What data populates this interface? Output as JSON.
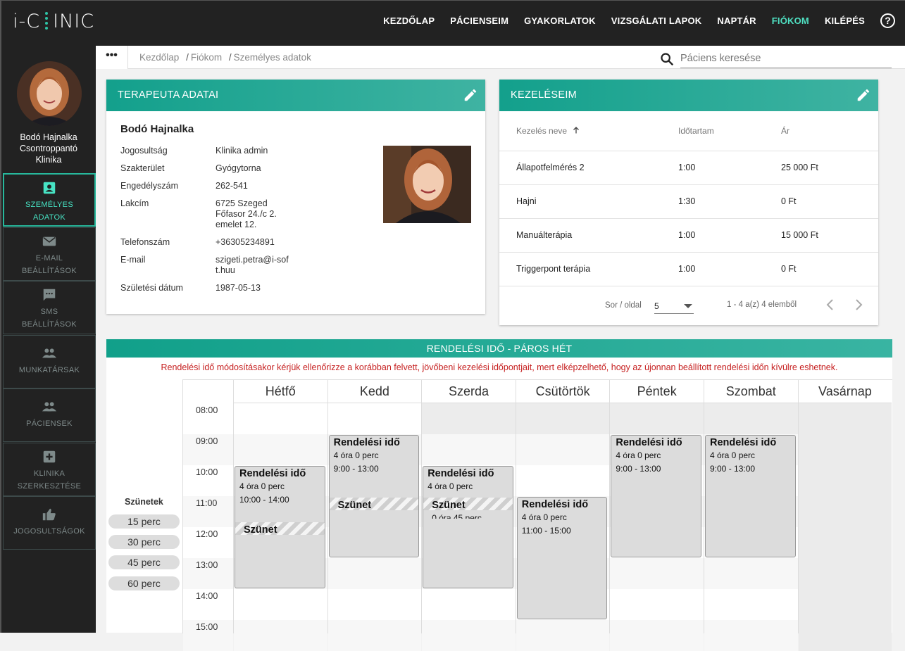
{
  "app": {
    "logo": "i-CINIC"
  },
  "nav": {
    "items": [
      "KEZDŐLAP",
      "PÁCIENSEIM",
      "GYAKORLATOK",
      "VIZSGÁLATI LAPOK",
      "NAPTÁR",
      "FIÓKOM",
      "KILÉPÉS"
    ],
    "active": "FIÓKOM",
    "help": "?"
  },
  "sidebar": {
    "user_name": "Bodó Hajnalka",
    "clinic_line1": "Csontroppantó",
    "clinic_line2": "Klinika",
    "items": [
      {
        "line1": "SZEMÉLYES",
        "line2": "ADATOK",
        "icon": "account-box-icon",
        "active": true
      },
      {
        "line1": "E-MAIL",
        "line2": "BEÁLLÍTÁSOK",
        "icon": "mail-icon"
      },
      {
        "line1": "SMS",
        "line2": "BEÁLLÍTÁSOK",
        "icon": "sms-icon"
      },
      {
        "line1": "MUNKATÁRSAK",
        "line2": "",
        "icon": "people-icon"
      },
      {
        "line1": "PÁCIENSEK",
        "line2": "",
        "icon": "people-icon"
      },
      {
        "line1": "KLINIKA",
        "line2": "SZERKESZTÉSE",
        "icon": "plus-box-icon"
      },
      {
        "line1": "JOGOSULTSÁGOK",
        "line2": "",
        "icon": "thumb-up-icon"
      }
    ]
  },
  "breadcrumb": {
    "dots": "•••",
    "items": [
      "Kezdőlap",
      "Fiókom",
      "Személyes adatok"
    ],
    "sep": "/"
  },
  "search": {
    "placeholder": "Páciens keresése"
  },
  "therapist": {
    "title": "TERAPEUTA ADATAI",
    "name": "Bodó Hajnalka",
    "rows": [
      {
        "k": "Jogosultság",
        "v": "Klinika admin"
      },
      {
        "k": "Szakterület",
        "v": "Gyógytorna"
      },
      {
        "k": "Engedélyszám",
        "v": "262-541"
      },
      {
        "k": "Lakcím",
        "v": "6725 Szeged Főfasor 24./c 2. emelet 12."
      },
      {
        "k": "Telefonszám",
        "v": "+36305234891"
      },
      {
        "k": "E-mail",
        "v": "szigeti.petra@i-soft.huu"
      },
      {
        "k": "Születési dátum",
        "v": "1987-05-13"
      }
    ]
  },
  "treatments": {
    "title": "KEZELÉSEIM",
    "columns": [
      "Kezelés neve",
      "Időtartam",
      "Ár"
    ],
    "rows": [
      [
        "Állapotfelmérés 2",
        "1:00",
        "25 000 Ft"
      ],
      [
        "Hajni",
        "1:30",
        "0 Ft"
      ],
      [
        "Manuálterápia",
        "1:00",
        "15 000 Ft"
      ],
      [
        "Triggerpont terápia",
        "1:00",
        "0 Ft"
      ]
    ],
    "rows_per_page_label": "Sor / oldal",
    "rows_per_page": "5",
    "range": "1 - 4 a(z) 4 elemből"
  },
  "schedule": {
    "title": "RENDELÉSI IDŐ - PÁROS HÉT",
    "warning": "Rendelési idő módosításakor kérjük ellenőrizze a korábban felvett, jövőbeni kezelési időpontjait, mert elképzelhető, hogy az újonnan beállított rendelési időn kívülre eshetnek.",
    "breaks_title": "Szünetek",
    "breaks": [
      "15 perc",
      "30 perc",
      "45 perc",
      "60 perc"
    ],
    "days": [
      "Hétfő",
      "Kedd",
      "Szerda",
      "Csütörtök",
      "Péntek",
      "Szombat",
      "Vasárnap"
    ],
    "times": [
      "08:00",
      "09:00",
      "10:00",
      "11:00",
      "12:00",
      "13:00",
      "14:00",
      "15:00"
    ],
    "blocks": [
      {
        "day": 0,
        "title": "Rendelési idő",
        "duration": "4 óra 0 perc",
        "hours": "10:00 - 14:00",
        "start": 10,
        "end": 14
      },
      {
        "day": 1,
        "title": "Rendelési idő",
        "duration": "4 óra 0 perc",
        "hours": "9:00 - 13:00",
        "start": 9,
        "end": 13
      },
      {
        "day": 2,
        "title": "Rendelési idő",
        "duration": "4 óra 0 perc",
        "hours": "",
        "start": 10,
        "end": 14
      },
      {
        "day": 3,
        "title": "Rendelési idő",
        "duration": "4 óra 0 perc",
        "hours": "11:00 - 15:00",
        "start": 11,
        "end": 15
      },
      {
        "day": 4,
        "title": "Rendelési idő",
        "duration": "4 óra 0 perc",
        "hours": "9:00 - 13:00",
        "start": 9,
        "end": 13
      },
      {
        "day": 5,
        "title": "Rendelési idő",
        "duration": "4 óra 0 perc",
        "hours": "9:00 - 13:00",
        "start": 9,
        "end": 13
      }
    ],
    "break_blocks": [
      {
        "day": 0,
        "title": "Szünet",
        "detail": "",
        "start": 11.8
      },
      {
        "day": 1,
        "title": "Szünet",
        "detail": "",
        "start": 11.0
      },
      {
        "day": 2,
        "title": "Szünet",
        "detail": "0 óra 45 perc",
        "start": 11.0
      }
    ]
  }
}
